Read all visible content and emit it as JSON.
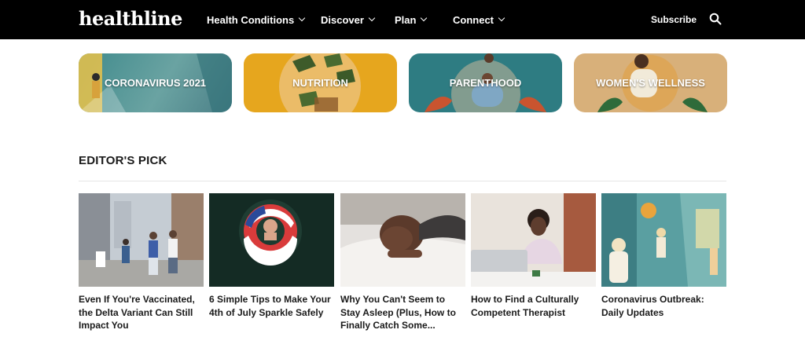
{
  "header": {
    "logo": "healthline",
    "nav": [
      {
        "label": "Health Conditions"
      },
      {
        "label": "Discover"
      },
      {
        "label": "Plan"
      },
      {
        "label": "Connect"
      }
    ],
    "subscribe_label": "Subscribe",
    "search_icon": "search-icon"
  },
  "topics": [
    {
      "label": "CORONAVIRUS 2021",
      "color": "#3f8a8c"
    },
    {
      "label": "NUTRITION",
      "color": "#e6a61e"
    },
    {
      "label": "PARENTHOOD",
      "color": "#2e7c82"
    },
    {
      "label": "WOMEN'S WELLNESS",
      "color": "#d8b07a"
    }
  ],
  "editors_pick": {
    "title": "EDITOR'S PICK",
    "articles": [
      {
        "title": "Even If You're Vaccinated, the Delta Variant Can Still Impact You"
      },
      {
        "title": "6 Simple Tips to Make Your 4th of July Sparkle Safely"
      },
      {
        "title": "Why You Can't Seem to Stay Asleep (Plus, How to Finally Catch Some..."
      },
      {
        "title": "How to Find a Culturally Competent Therapist"
      },
      {
        "title": "Coronavirus Outbreak: Daily Updates"
      }
    ]
  }
}
